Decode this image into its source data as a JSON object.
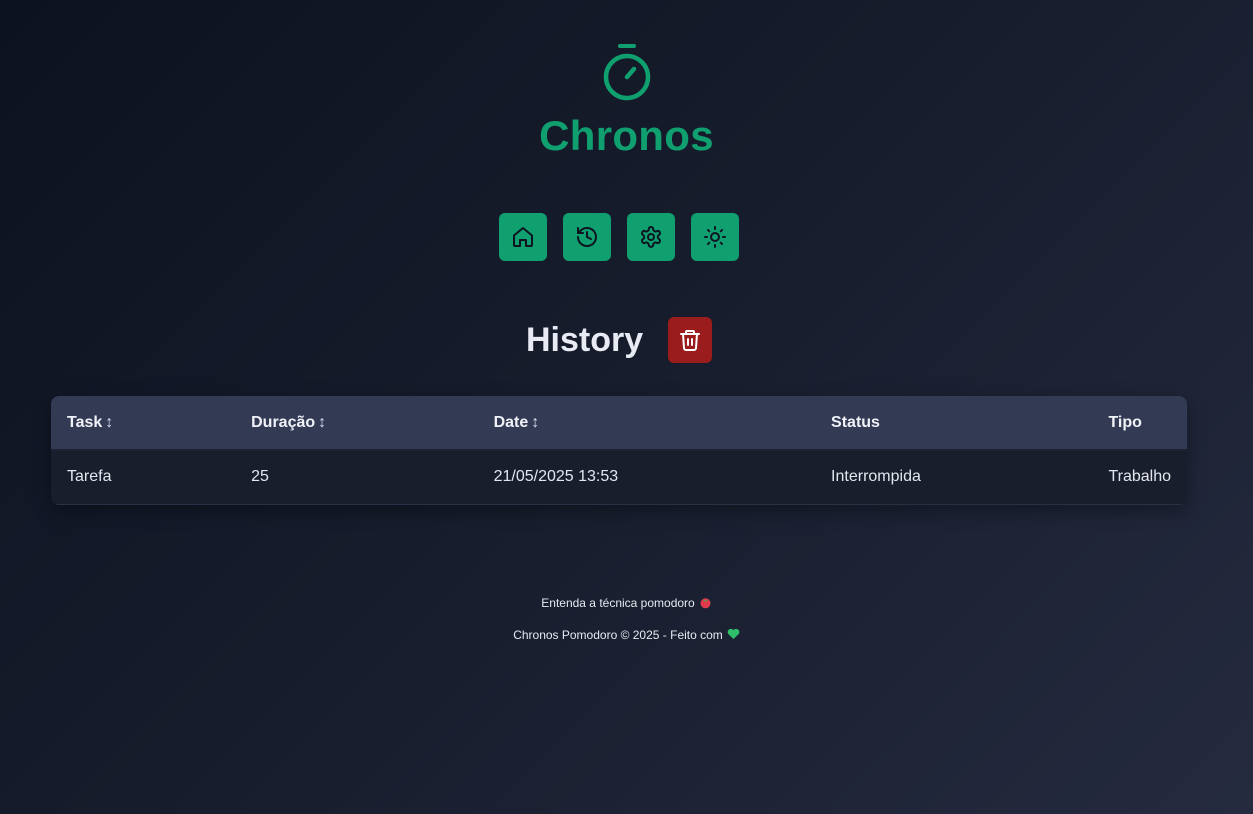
{
  "app": {
    "name": "Chronos",
    "accent_color": "#10a070",
    "danger_color": "#9b1c1c",
    "logo_icon": "stopwatch-icon"
  },
  "nav": {
    "items": [
      {
        "icon": "home-icon",
        "label": "Home"
      },
      {
        "icon": "history-icon",
        "label": "History"
      },
      {
        "icon": "gear-icon",
        "label": "Settings"
      },
      {
        "icon": "sun-icon",
        "label": "Toggle theme"
      }
    ]
  },
  "history": {
    "title": "History",
    "clear_icon": "trash-icon",
    "columns": [
      {
        "label": "Task",
        "sortable": true,
        "sort_glyph": "↕"
      },
      {
        "label": "Duração",
        "sortable": true,
        "sort_glyph": "↕"
      },
      {
        "label": "Date",
        "sortable": true,
        "sort_glyph": "↕"
      },
      {
        "label": "Status",
        "sortable": false
      },
      {
        "label": "Tipo",
        "sortable": false
      }
    ],
    "rows": [
      {
        "task": "Tarefa",
        "duration": "25",
        "date": "21/05/2025 13:53",
        "status": "Interrompida",
        "type": "Trabalho"
      }
    ]
  },
  "footer": {
    "link_text": "Entenda a técnica pomodoro",
    "link_emoji": "tomato-icon",
    "copyright_text": "Chronos Pomodoro © 2025 - Feito com",
    "copyright_emoji": "green-heart-icon"
  }
}
